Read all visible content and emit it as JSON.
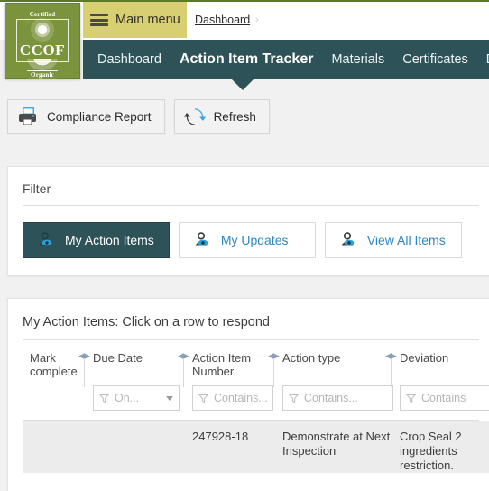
{
  "topbar": {
    "main_menu_label": "Main menu",
    "breadcrumb": {
      "item": "Dashboard",
      "separator": "›"
    }
  },
  "nav": {
    "items": [
      {
        "label": "Dashboard",
        "active": false
      },
      {
        "label": "Action Item Tracker",
        "active": true
      },
      {
        "label": "Materials",
        "active": false
      },
      {
        "label": "Certificates",
        "active": false
      },
      {
        "label": "Do",
        "active": false
      }
    ]
  },
  "logo": {
    "top_text": "Certified",
    "brand": "CCOF",
    "bottom_text": "Organic"
  },
  "toolbar": {
    "compliance_report_label": "Compliance Report",
    "refresh_label": "Refresh"
  },
  "filter_panel": {
    "title": "Filter",
    "buttons": [
      {
        "label": "My Action Items",
        "active": true
      },
      {
        "label": "My Updates",
        "active": false
      },
      {
        "label": "View All Items",
        "active": false
      }
    ]
  },
  "table_panel": {
    "title": "My Action Items: Click on a row to respond",
    "columns": [
      {
        "label": "Mark complete"
      },
      {
        "label": "Due Date"
      },
      {
        "label": "Action Item Number"
      },
      {
        "label": "Action type"
      },
      {
        "label": "Deviation"
      }
    ],
    "filters": [
      {
        "placeholder": "",
        "type": "none"
      },
      {
        "placeholder": "On...",
        "type": "dropdown"
      },
      {
        "placeholder": "Contains...",
        "type": "text"
      },
      {
        "placeholder": "Contains...",
        "type": "text"
      },
      {
        "placeholder": "Contains",
        "type": "text"
      }
    ],
    "rows": [
      {
        "mark_complete": "",
        "due_date": "",
        "action_item_number": "247928-18",
        "action_type": "Demonstrate at Next Inspection",
        "deviation": "Crop Seal 2 ingredients restriction."
      }
    ]
  },
  "colors": {
    "nav_teal": "#2d5359",
    "menu_gold": "#d8cf72",
    "accent_blue": "#2f87c4",
    "logo_green": "#7b933d"
  }
}
